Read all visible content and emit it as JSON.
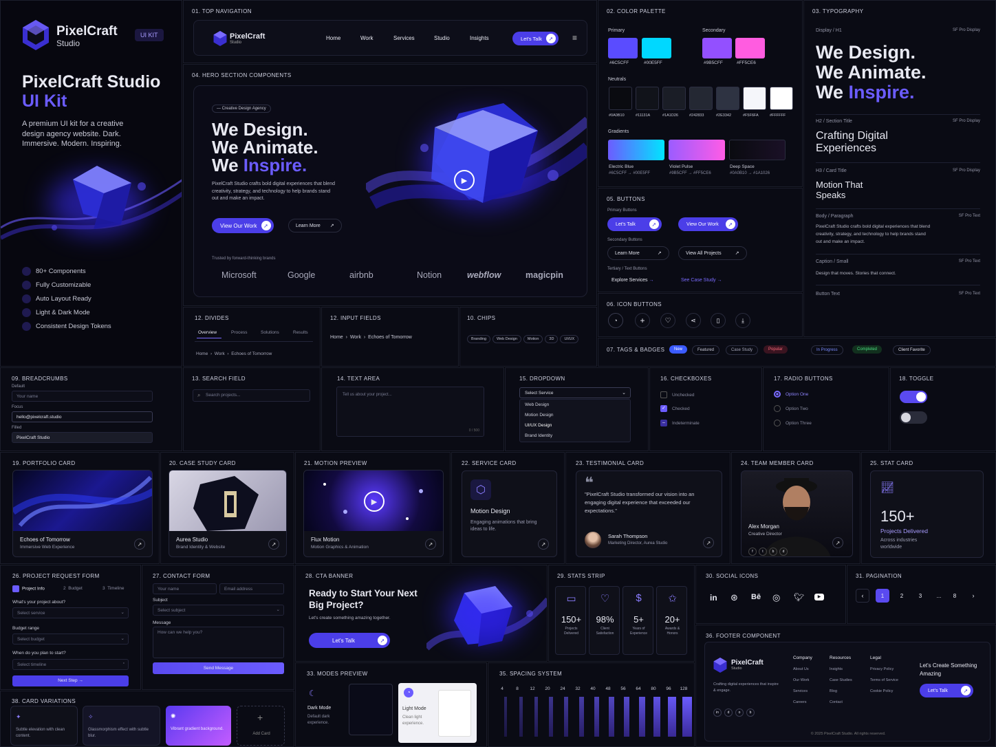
{
  "brand": {
    "name": "PixelCraft",
    "sub": "Studio",
    "badge": "UI KIT",
    "title_a": "PixelCraft Studio",
    "title_b": "UI Kit",
    "desc": "A premium UI kit for a creative design agency website. Dark. Immersive. Modern. Inspiring.",
    "features": [
      "80+ Components",
      "Fully Customizable",
      "Auto Layout Ready",
      "Light & Dark Mode",
      "Consistent Design Tokens"
    ]
  },
  "nav": {
    "label": "01. TOP NAVIGATION",
    "brand": "PixelCraft",
    "brand_sub": "Studio",
    "links": [
      "Home",
      "Work",
      "Services",
      "Studio",
      "Insights"
    ],
    "cta": "Let's Talk"
  },
  "palette": {
    "label": "02. COLOR PALETTE",
    "primary": "Primary",
    "secondary": "Secondary",
    "neutrals": "Neutrals",
    "gradients": "Gradients",
    "primary_colors": [
      {
        "hex": "#6C5CFF",
        "label": "#6C5CFF"
      },
      {
        "hex": "#00E5FF",
        "label": "#00E5FF"
      }
    ],
    "secondary_colors": [
      {
        "hex": "#9B5CFF",
        "label": "#9B5CFF"
      },
      {
        "hex": "#FF5CE6",
        "label": "#FF5CE6"
      }
    ],
    "neutral_colors": [
      {
        "hex": "#0A0B10",
        "label": "#0A0B10"
      },
      {
        "hex": "#11131A",
        "label": "#11131A"
      },
      {
        "hex": "#1A1D26",
        "label": "#1A1D26"
      },
      {
        "hex": "#242833",
        "label": "#242833"
      },
      {
        "hex": "#2E3342",
        "label": "#2E3342"
      },
      {
        "hex": "#F5F6FA",
        "label": "#F5F6FA"
      },
      {
        "hex": "#FFFFFF",
        "label": "#FFFFFF"
      }
    ],
    "gradient_items": [
      {
        "name": "Electric Blue",
        "stops": "#6C5CFF → #00E5FF"
      },
      {
        "name": "Violet Pulse",
        "stops": "#9B5CFF → #FF5CE6"
      },
      {
        "name": "Deep Space",
        "stops": "#0A0B10 → #1A1026"
      }
    ]
  },
  "typo": {
    "label": "03. TYPOGRAPHY",
    "display": "Display / H1",
    "font": "SF Pro Display",
    "font_text": "SF Pro Text",
    "h1a": "We Design.",
    "h1b": "We Animate.",
    "h1c": "We",
    "h1d": "Inspire.",
    "h2label": "H2 / Section Title",
    "h2": "Crafting Digital Experiences",
    "h3label": "H3 / Card Title",
    "h3": "Motion That Speaks",
    "bodylabel": "Body / Paragraph",
    "body": "PixelCraft Studio crafts bold digital experiences that blend creativity, strategy, and technology to help brands stand out and make an impact.",
    "caplabel": "Caption / Small",
    "caption": "Design that moves. Stories that connect.",
    "btnlabel": "Button Text"
  },
  "hero": {
    "label": "04. HERO SECTION COMPONENTS",
    "tag": "Creative Design Agency",
    "l1": "We Design.",
    "l2": "We Animate.",
    "l3a": "We",
    "l3b": "Inspire.",
    "desc": "PixelCraft Studio crafts bold digital experiences that blend creativity, strategy, and technology to help brands stand out and make an impact.",
    "cta1": "View Our Work",
    "cta2": "Learn More",
    "trusted": "Trusted by forward-thinking brands",
    "logos": [
      "Microsoft",
      "Google",
      "airbnb",
      "Notion",
      "webflow",
      "magicpin"
    ]
  },
  "buttons": {
    "label": "05. BUTTONS",
    "primary": "Primary Buttons",
    "p1": "Let's Talk",
    "p2": "View Our Work",
    "secondary": "Secondary Buttons",
    "s1": "Learn More",
    "s2": "View All Projects",
    "tertiary": "Tertiary / Text Buttons",
    "t1": "Explore Services",
    "t2": "See Case Study"
  },
  "iconbtn": {
    "label": "06. ICON BUTTONS"
  },
  "tags": {
    "label": "07. TAGS & BADGES",
    "items": [
      "New",
      "Featured",
      "Case Study",
      "Popular",
      "In Progress",
      "Completed",
      "Client Favorite"
    ]
  },
  "dividers": {
    "label": "12. DIVIDES",
    "tabs": [
      "Overview",
      "Process",
      "Solutions",
      "Results"
    ],
    "crumbs": [
      "Home",
      "Work",
      "Echoes of Tomorrow"
    ]
  },
  "inputf": {
    "label": "12. INPUT FIELDS",
    "crumbs": [
      "Home",
      "Work",
      "Echoes of Tomorrow"
    ]
  },
  "chips": {
    "label": "10. CHIPS",
    "items": [
      "Branding",
      "Web Design",
      "Motion",
      "3D",
      "UI/UX"
    ]
  },
  "bread": {
    "label": "09. BREADCRUMBS",
    "default": "Default",
    "v1": "Your name",
    "focus": "Focus",
    "v2": "hello@pixelcraft.studio",
    "filled": "Filled",
    "v3": "PixelCraft Studio"
  },
  "search": {
    "label": "13. SEARCH FIELD",
    "ph": "Search projects..."
  },
  "textarea": {
    "label": "14. TEXT AREA",
    "ph": "Tell us about your project...",
    "count": "0 / 500"
  },
  "dropdown": {
    "label": "15. DROPDOWN",
    "value": "Select Service",
    "options": [
      "Web Design",
      "Motion Design",
      "UI/UX Design",
      "Brand Identity"
    ]
  },
  "checks": {
    "label": "16. CHECKBOXES",
    "items": [
      "Unchecked",
      "Checked",
      "Indeterminate"
    ]
  },
  "radios": {
    "label": "17. RADIO BUTTONS",
    "items": [
      "Option One",
      "Option Two",
      "Option Three"
    ]
  },
  "toggle": {
    "label": "18. TOGGLE"
  },
  "portfolio": {
    "label": "19. PORTFOLIO CARD",
    "title": "Echoes of Tomorrow",
    "sub": "Immersive Web Experience"
  },
  "casestudy": {
    "label": "20. CASE STUDY CARD",
    "title": "Aurea Studio",
    "sub": "Brand Identity & Website"
  },
  "motion": {
    "label": "21. MOTION PREVIEW",
    "title": "Flux Motion",
    "sub": "Motion Graphics & Animation"
  },
  "service": {
    "label": "22. SERVICE CARD",
    "title": "Motion Design",
    "desc": "Engaging animations that bring ideas to life."
  },
  "testimonial": {
    "label": "23. TESTIMONIAL CARD",
    "quote": "\"PixelCraft Studio transformed our vision into an engaging digital experience that exceeded our expectations.\"",
    "name": "Sarah Thompson",
    "role": "Marketing Director, Aurea Studio"
  },
  "team": {
    "label": "24. TEAM MEMBER CARD",
    "name": "Alex Morgan",
    "role": "Creative Director"
  },
  "stat": {
    "label": "25. STAT CARD",
    "value": "150+",
    "title": "Projects Delivered",
    "sub": "Across industries worldwide"
  },
  "form": {
    "label": "26. PROJECT REQUEST FORM",
    "steps": [
      "Project Info",
      "2  Budget",
      "3  Timeline"
    ],
    "q1": "What's your project about?",
    "s1": "Select service",
    "q2": "Budget range",
    "s2": "Select budget",
    "q3": "When do you plan to start?",
    "s3": "Select timeline",
    "next": "Next Step"
  },
  "contact": {
    "label": "27. CONTACT FORM",
    "name": "Your name",
    "email": "Email address",
    "subject": "Subject",
    "subject_ph": "Select subject",
    "message": "Message",
    "message_ph": "How can we help you?",
    "send": "Send Message"
  },
  "ctab": {
    "label": "28. CTA BANNER",
    "title": "Ready to Start Your Next Big Project?",
    "sub": "Let's create something amazing together.",
    "cta": "Let's Talk"
  },
  "stats": {
    "label": "29. STATS STRIP",
    "items": [
      {
        "v": "150+",
        "l": "Projects Delivered"
      },
      {
        "v": "98%",
        "l": "Client Satisfaction"
      },
      {
        "v": "5+",
        "l": "Years of Experience"
      },
      {
        "v": "20+",
        "l": "Awards & Honors"
      }
    ]
  },
  "social": {
    "label": "30. SOCIAL ICONS"
  },
  "pagination": {
    "label": "31. PAGINATION",
    "pages": [
      "1",
      "2",
      "3",
      "...",
      "8"
    ]
  },
  "modes": {
    "label": "33. MODES PREVIEW",
    "dark": "Dark Mode",
    "dark_sub": "Default dark experience.",
    "light": "Light Mode",
    "light_sub": "Clean light experience."
  },
  "spacing": {
    "label": "35. SPACING SYSTEM",
    "values": [
      4,
      8,
      12,
      20,
      24,
      32,
      40,
      48,
      56,
      64,
      80,
      96,
      128
    ]
  },
  "footer": {
    "label": "36. FOOTER COMPONENT",
    "brand": "PixelCraft",
    "brand_sub": "Studio",
    "desc": "Crafting digital experiences that inspire & engage.",
    "c1": "Company",
    "c1i": [
      "About Us",
      "Our Work",
      "Services",
      "Careers"
    ],
    "c2": "Resources",
    "c2i": [
      "Insights",
      "Case Studies",
      "Blog",
      "Contact"
    ],
    "c3": "Legal",
    "c3i": [
      "Privacy Policy",
      "Terms of Service",
      "Cookie Policy"
    ],
    "cta_t": "Let's Create Something Amazing",
    "cta": "Let's Talk",
    "copy": "© 2025 PixelCraft Studio. All rights reserved."
  },
  "cards": {
    "label": "38. CARD VARIATIONS",
    "c1": "Subtle elevation with clean content.",
    "c2": "Glassmorphism effect with subtle blur.",
    "c3": "Vibrant gradient background.",
    "add": "Add Card"
  }
}
